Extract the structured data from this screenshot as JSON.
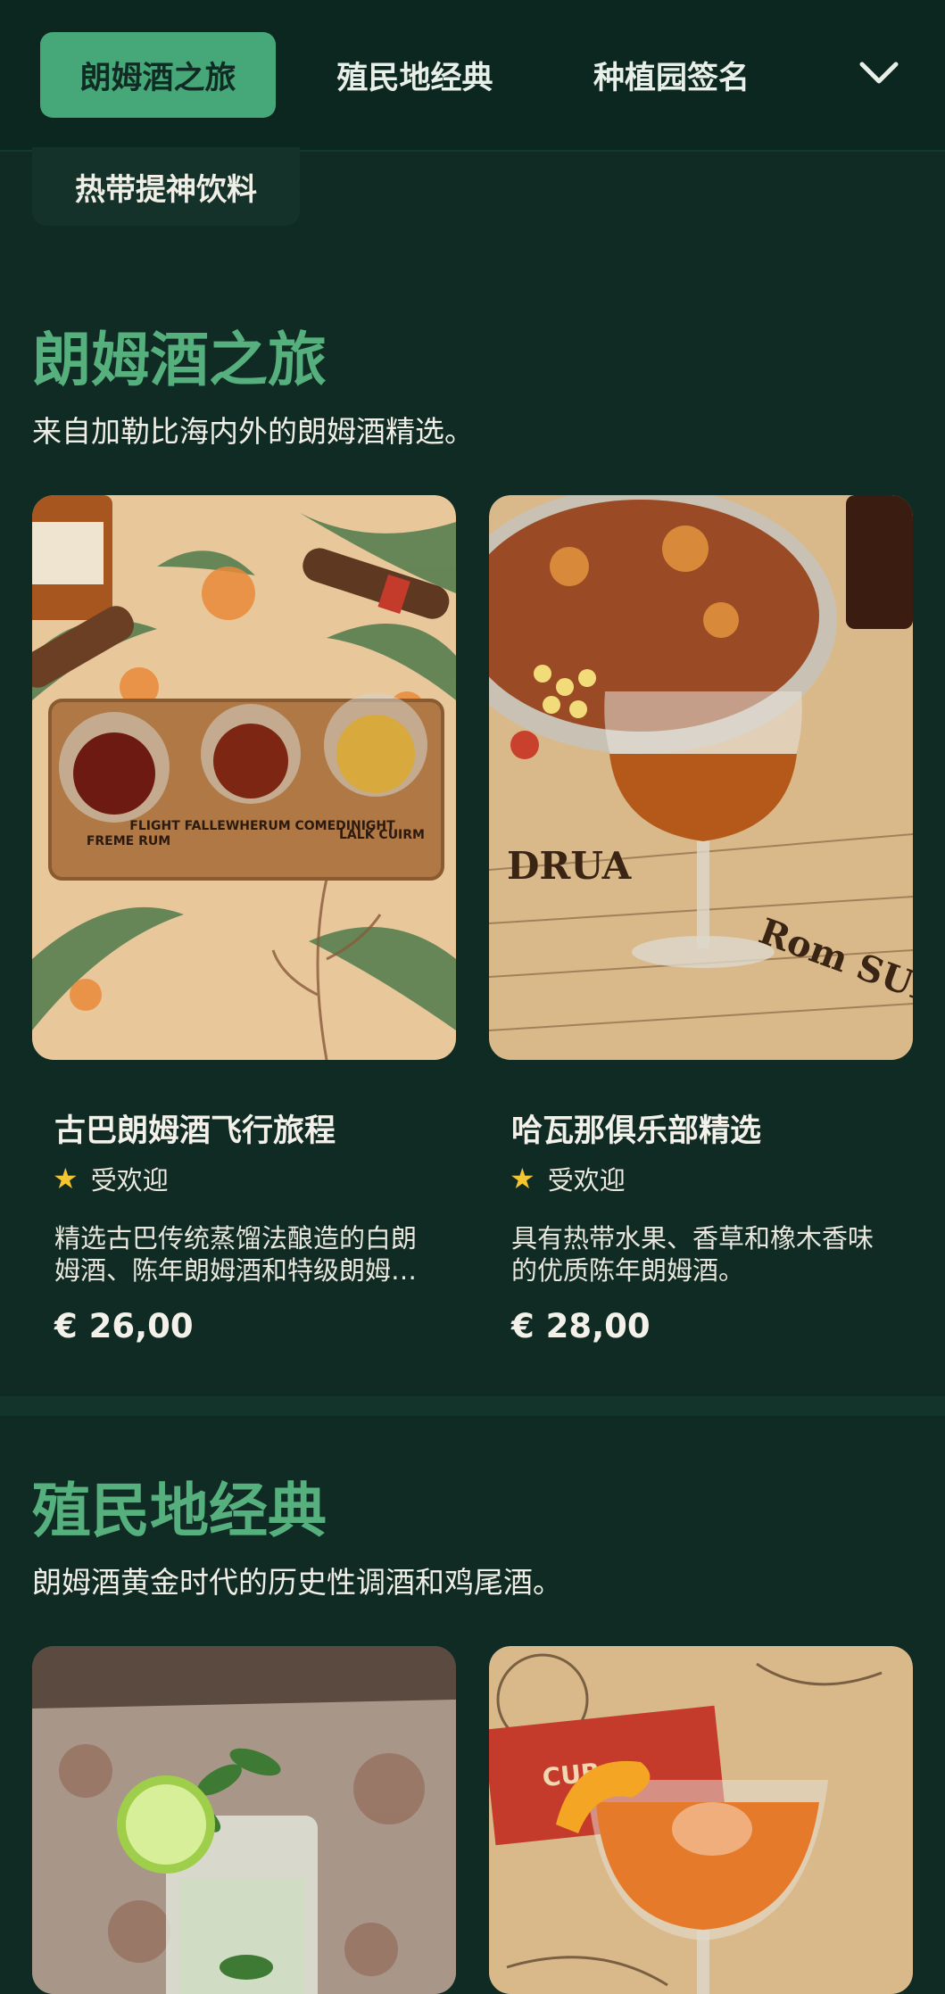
{
  "tabs": [
    {
      "label": "朗姆酒之旅",
      "active": true
    },
    {
      "label": "殖民地经典",
      "active": false
    },
    {
      "label": "种植园签名",
      "active": false
    }
  ],
  "overflow_chip": {
    "label": "热带提神饮料"
  },
  "sections": [
    {
      "title": "朗姆酒之旅",
      "subtitle": "来自加勒比海内外的朗姆酒精选。",
      "cards": [
        {
          "name": "古巴朗姆酒飞行旅程",
          "badge": "受欢迎",
          "description": "精选古巴传统蒸馏法酿造的白朗姆酒、陈年朗姆酒和特级朗姆…",
          "price": "€ 26,00",
          "image_icon": "rum-flight-photo",
          "image_labels": [
            "FREME RUM",
            "FLIGHT FALLEWHERUM COMEDINIGHT",
            "LALK CUIRM"
          ]
        },
        {
          "name": "哈瓦那俱乐部精选",
          "badge": "受欢迎",
          "description": "具有热带水果、香草和橡木香味的优质陈年朗姆酒。",
          "price": "€ 28,00",
          "image_icon": "rum-glass-photo"
        }
      ]
    },
    {
      "title": "殖民地经典",
      "subtitle": "朗姆酒黄金时代的历史性调酒和鸡尾酒。",
      "cards": [
        {
          "image_icon": "mojito-photo"
        },
        {
          "image_icon": "orange-cocktail-photo"
        }
      ]
    }
  ],
  "colors": {
    "background": "#0f2b23",
    "accent": "#46a878",
    "section_title": "#55b07e",
    "star": "#f2c531"
  }
}
